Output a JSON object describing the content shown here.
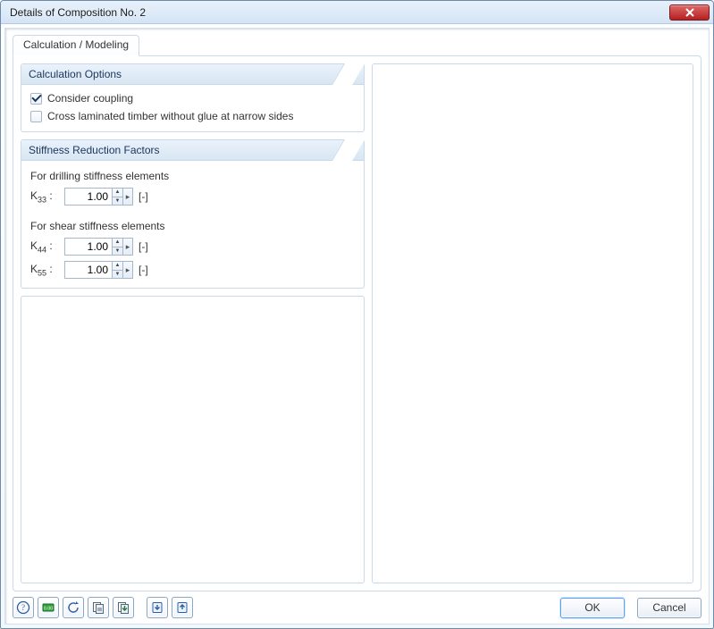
{
  "window": {
    "title": "Details of Composition No. 2"
  },
  "tabs": [
    {
      "label": "Calculation / Modeling"
    }
  ],
  "calc_options": {
    "title": "Calculation Options",
    "consider_coupling": {
      "label": "Consider coupling",
      "checked": true
    },
    "clt_no_glue": {
      "label": "Cross laminated timber without glue at narrow sides",
      "checked": false
    }
  },
  "stiffness": {
    "title": "Stiffness Reduction Factors",
    "drilling_label": "For drilling stiffness elements",
    "shear_label": "For shear stiffness elements",
    "k33": {
      "label": "K",
      "sub": "33",
      "colon": " :",
      "value": "1.00",
      "unit": "[-]"
    },
    "k44": {
      "label": "K",
      "sub": "44",
      "colon": " :",
      "value": "1.00",
      "unit": "[-]"
    },
    "k55": {
      "label": "K",
      "sub": "55",
      "colon": " :",
      "value": "1.00",
      "unit": "[-]"
    }
  },
  "buttons": {
    "ok": "OK",
    "cancel": "Cancel"
  },
  "toolbar_icons": [
    "help-icon",
    "units-icon",
    "reset-icon",
    "copy-props-icon",
    "load-defaults-icon",
    "import-icon",
    "export-icon"
  ]
}
